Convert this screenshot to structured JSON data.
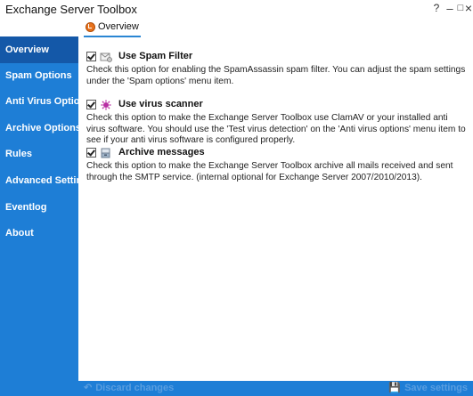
{
  "window": {
    "title": "Exchange Server Toolbox",
    "help_glyph": "?",
    "minimize_glyph": "–",
    "maximize_glyph": "□",
    "close_glyph": "×"
  },
  "tabs": [
    {
      "label": "Overview",
      "active": true,
      "icon": "overview-icon"
    }
  ],
  "sidebar": {
    "items": [
      {
        "label": "Overview",
        "active": true
      },
      {
        "label": "Spam Options",
        "active": false
      },
      {
        "label": "Anti Virus Options",
        "active": false
      },
      {
        "label": "Archive Options",
        "active": false
      },
      {
        "label": "Rules",
        "active": false
      },
      {
        "label": "Advanced Settings",
        "active": false
      },
      {
        "label": "Eventlog",
        "active": false
      },
      {
        "label": "About",
        "active": false
      }
    ]
  },
  "sections": [
    {
      "checked": true,
      "icon": "spam-filter-icon",
      "title": "Use Spam Filter",
      "description": "Check this option for enabling the SpamAssassin spam filter. You can adjust the spam settings under the 'Spam options' menu item."
    },
    {
      "checked": true,
      "icon": "virus-icon",
      "title": "Use virus scanner",
      "description": "Check this option to make the Exchange Server Toolbox use ClamAV or your installed anti virus software. You should use the 'Test virus detection' on the 'Anti virus options' menu item to see if your anti virus software is configured properly."
    },
    {
      "checked": true,
      "icon": "archive-icon",
      "title": "Archive messages",
      "description": "Check this option to make the Exchange Server Toolbox archive all mails received and sent through the SMTP service. (internal optional for Exchange Server 2007/2010/2013)."
    }
  ],
  "footer": {
    "discard_label": "Discard changes",
    "save_label": "Save settings",
    "discard_glyph": "↶",
    "save_glyph": "💾"
  },
  "colors": {
    "sidebar": "#1e7ed6",
    "sidebar_active": "#1458a8",
    "accent": "#2a86d3"
  }
}
